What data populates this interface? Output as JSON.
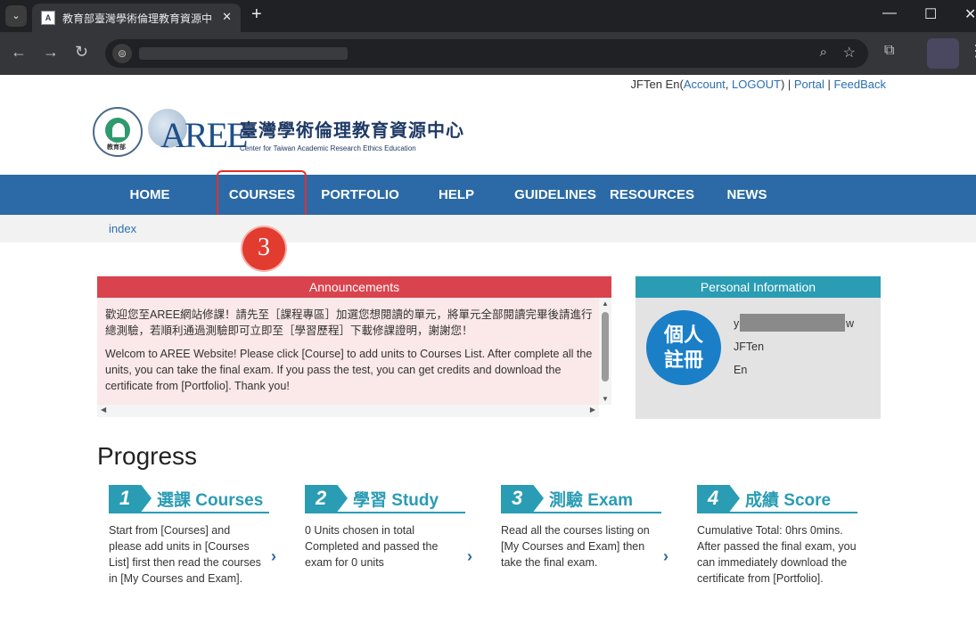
{
  "browser": {
    "tab_title": "教育部臺灣學術倫理教育資源中",
    "favicon_text": "A",
    "tab_list_glyph": "⌄",
    "tab_close": "✕",
    "new_tab": "+",
    "window_minimize": "—",
    "window_maximize": "☐",
    "window_close": "✕",
    "back": "←",
    "forward": "→",
    "reload": "↻",
    "site_info": "⊜",
    "zoom": "⌕",
    "bookmark": "☆",
    "extensions": "⧉",
    "menu": "⋮"
  },
  "header": {
    "user_name": "JFTen En",
    "account_label": "Account",
    "logout_label": "LOGOUT",
    "portal_label": "Portal",
    "feedback_label": "FeedBack",
    "org_name_zh": "臺灣學術倫理教育資源中心",
    "org_name_en": "Center for Taiwan Academic Research Ethics Education",
    "logo_text": "AREE",
    "seal_text": "教育部"
  },
  "nav": {
    "items": [
      {
        "label": "HOME"
      },
      {
        "label": "COURSES"
      },
      {
        "label": "PORTFOLIO"
      },
      {
        "label": "HELP"
      },
      {
        "label": "GUIDELINES"
      },
      {
        "label": "RESOURCES"
      },
      {
        "label": "NEWS"
      }
    ]
  },
  "breadcrumb": {
    "current": "index"
  },
  "annotation": {
    "step_number": "3",
    "highlight_color": "#e03030"
  },
  "announcements": {
    "title": "Announcements",
    "zh": "歡迎您至AREE網站修課！請先至［課程專區］加選您想閱讀的單元，將單元全部閱讀完畢後請進行總測驗，若順利通過測驗即可立即至［學習歷程］下載修課證明，謝謝您！",
    "en": "Welcom to AREE Website! Please click [Course] to add units to Courses List. After complete all the units, you can take the final exam.  If you pass the test, you can get credits and download the certificate from [Portfolio]. Thank you!"
  },
  "personal": {
    "title": "Personal Information",
    "register_line1": "個人",
    "register_line2": "註冊",
    "email_prefix": "y",
    "email_suffix": "w",
    "first_name": "JFTen",
    "last_name": "En"
  },
  "progress": {
    "title": "Progress",
    "steps": [
      {
        "num": "1",
        "label": "選課 Courses",
        "desc": "Start from [Courses] and please add units in [Courses List] first then read the courses in [My Courses and Exam]."
      },
      {
        "num": "2",
        "label": "學習 Study",
        "desc": "0 Units chosen in total Completed and passed the exam for 0 units"
      },
      {
        "num": "3",
        "label": "測驗 Exam",
        "desc": "Read all the courses listing on [My Courses and Exam] then take the final exam."
      },
      {
        "num": "4",
        "label": "成績 Score",
        "desc": "Cumulative Total: 0hrs 0mins. After passed the final exam, you can immediately download the certificate from [Portfolio]."
      }
    ],
    "arrow": "›"
  },
  "colors": {
    "nav_blue": "#2b6aa6",
    "announce_red": "#d9434e",
    "teal": "#2a9cb4"
  }
}
